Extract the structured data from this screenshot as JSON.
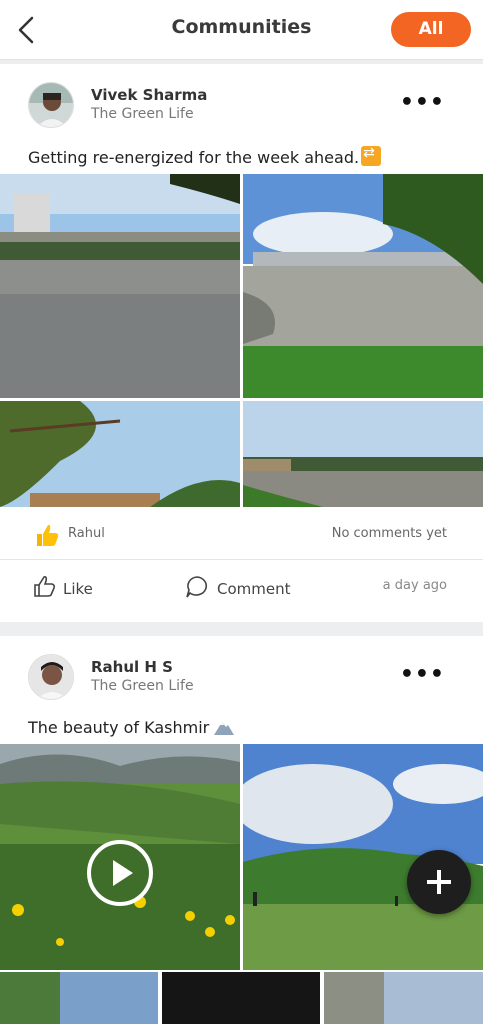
{
  "header": {
    "title": "Communities",
    "filter_label": "All"
  },
  "posts": [
    {
      "author": "Vivek Sharma",
      "community": "The Green Life",
      "text": "Getting re-energized for the week ahead.",
      "text_emoji_icon": "repeat-emoji-icon",
      "reactions": {
        "reactor": "Rahul",
        "comments": "No comments yet"
      },
      "actions": {
        "like": "Like",
        "comment": "Comment"
      },
      "time": "a day ago"
    },
    {
      "author": "Rahul H S",
      "community": "The Green Life",
      "text": "The beauty of Kashmir",
      "text_emoji_icon": "mountain-emoji-icon"
    }
  ],
  "colors": {
    "accent": "#f26522",
    "fab": "#1e1e1e"
  }
}
